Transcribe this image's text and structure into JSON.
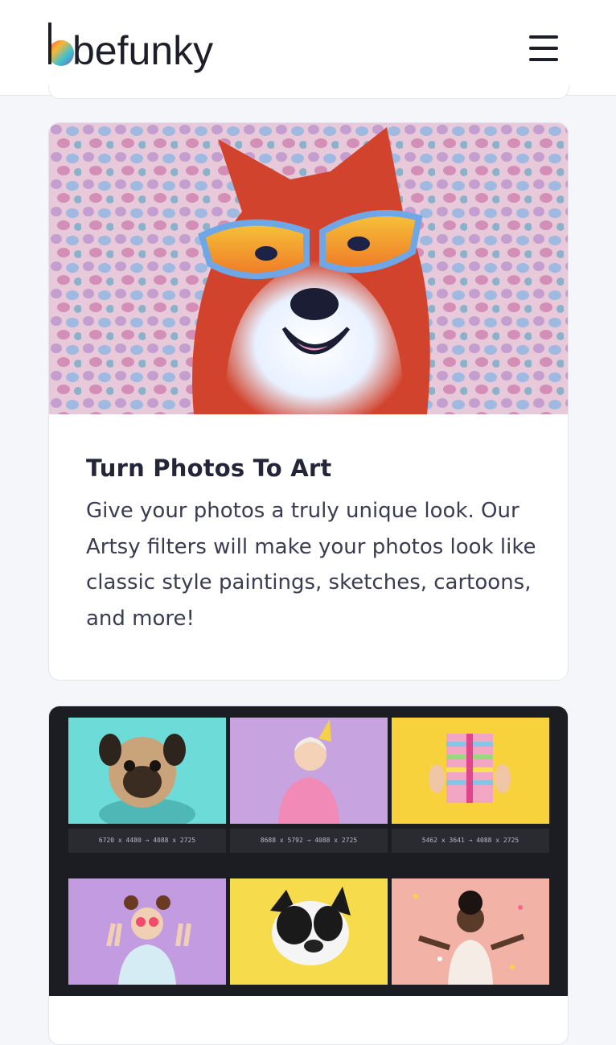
{
  "header": {
    "logo_text": "befunky",
    "menu_icon": "hamburger-menu-icon"
  },
  "feature_card": {
    "title": "Turn Photos To Art",
    "description": "Give your photos a truly unique look. Our Artsy filters will make your photos look like classic style paintings, sketches, cartoons, and more!",
    "image_icon": "artsy-dog-painting"
  },
  "batch_card": {
    "resolutions": [
      "6720 x 4480 → 4088 x 2725",
      "8688 x 5792 → 4088 x 2725",
      "5462 x 3641 → 4088 x 2725"
    ],
    "tiles": [
      "pug-photo",
      "senior-woman-party-photo",
      "gift-box-photo",
      "girl-peace-sign-photo",
      "french-bulldog-photo",
      "confetti-woman-photo"
    ]
  },
  "colors": {
    "accent": "#25253a",
    "background": "#f5f6f9",
    "dark_panel": "#1c1d22"
  }
}
